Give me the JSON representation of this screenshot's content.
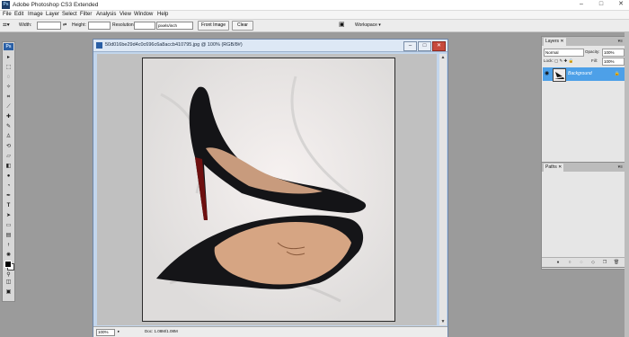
{
  "window": {
    "title": "Adobe Photoshop CS3 Extended",
    "app_icon": "Ps",
    "min": "–",
    "max": "□",
    "close": "✕"
  },
  "menus": [
    "File",
    "Edit",
    "Image",
    "Layer",
    "Select",
    "Filter",
    "Analysis",
    "View",
    "Window",
    "Help"
  ],
  "options": {
    "width_label": "Width:",
    "height_label": "Height:",
    "resolution_label": "Resolution:",
    "resolution_unit": "pixels/inch",
    "front_image": "Front Image",
    "clear": "Clear",
    "workspace": "Workspace ▾"
  },
  "toolbox": {
    "logo": "Ps"
  },
  "document": {
    "title": "50d016be29d4c0c696c6a8accb410795.jpg @ 100% (RGB/8#)",
    "zoom": "100%",
    "doc_size": "Doc: 1.08M/1.08M"
  },
  "layers_panel": {
    "tab": "Layers",
    "blend_mode": "Normal",
    "opacity_label": "Opacity:",
    "opacity": "100%",
    "lock_label": "Lock:",
    "fill_label": "Fill:",
    "fill": "100%",
    "layer_name": "Background"
  },
  "paths_panel": {
    "tab": "Paths"
  },
  "colors": {
    "selection": "#4da0e8"
  }
}
